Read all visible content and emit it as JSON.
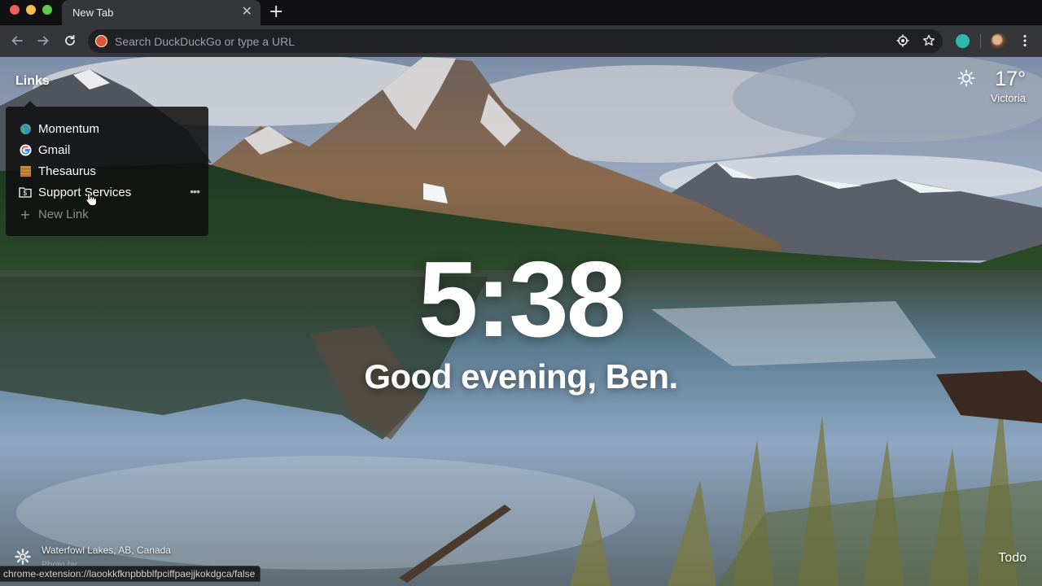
{
  "browser": {
    "tab": {
      "title": "New Tab",
      "close_icon": "close-icon"
    },
    "new_tab_icon": "plus-icon",
    "omnibox": {
      "placeholder": "Search DuckDuckGo or type a URL",
      "value": ""
    },
    "status_url": "chrome-extension://laookkfknpbbblfpciffpaejjkokdgca/false"
  },
  "links": {
    "label": "Links",
    "items": [
      {
        "label": "Momentum",
        "icon": "globe-icon"
      },
      {
        "label": "Gmail",
        "icon": "google-icon"
      },
      {
        "label": "Thesaurus",
        "icon": "thesaurus-icon"
      },
      {
        "label": "Support Services",
        "icon": "dollar-folder-icon"
      }
    ],
    "new_link_label": "New Link",
    "more_label": "•••"
  },
  "weather": {
    "temperature": "17°",
    "location": "Victoria",
    "icon": "sun-icon"
  },
  "clock": {
    "time": "5:38"
  },
  "greeting": {
    "text": "Good evening, Ben."
  },
  "footer": {
    "photo_location": "Waterfowl Lakes, AB, Canada",
    "photo_credit": "Photo by ",
    "todo_label": "Todo"
  },
  "colors": {
    "accent": "#2bbbad",
    "ddg": "#de5833",
    "panel": "#0f0f0f"
  }
}
